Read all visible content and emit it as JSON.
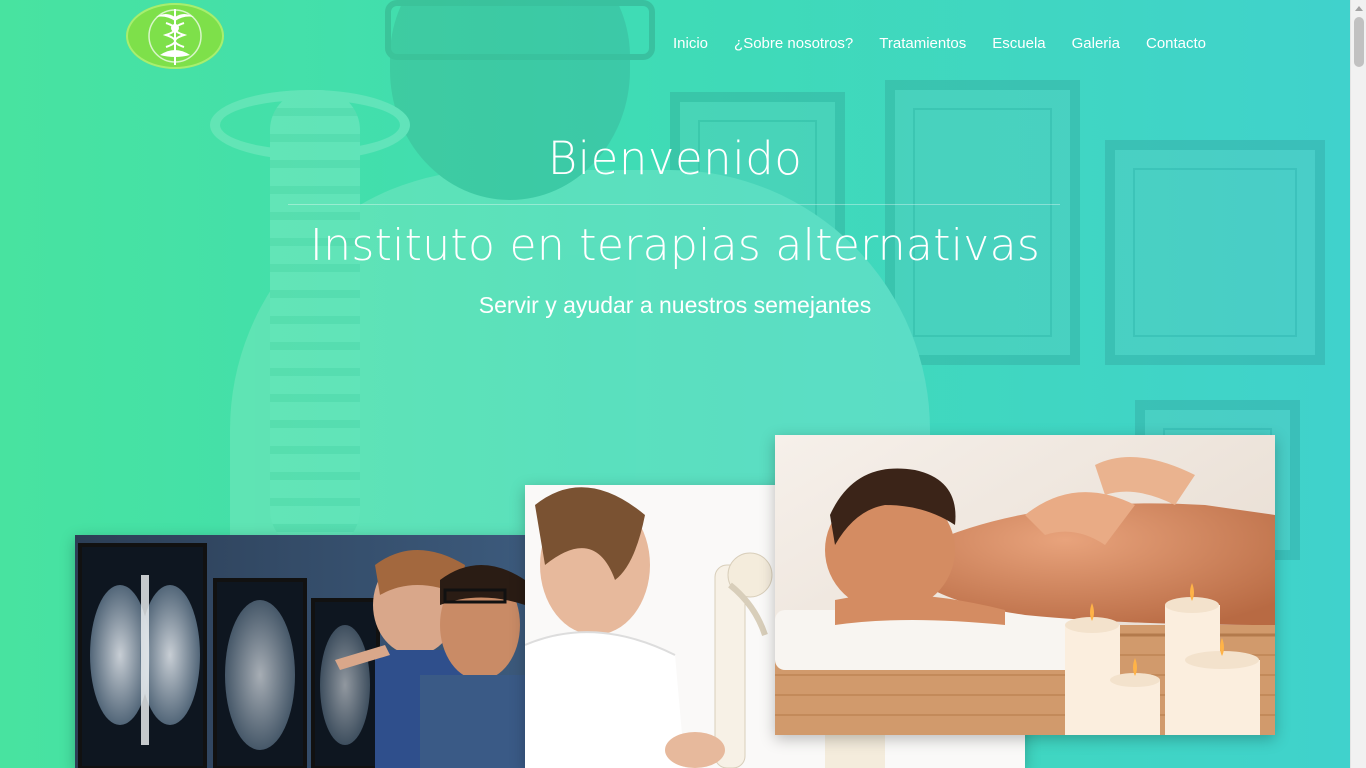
{
  "nav": {
    "logo_icon": "caduceus-meditation-logo-icon",
    "items": [
      {
        "label": "Inicio"
      },
      {
        "label": "¿Sobre nosotros?"
      },
      {
        "label": "Tratamientos"
      },
      {
        "label": "Escuela"
      },
      {
        "label": "Galeria"
      },
      {
        "label": "Contacto"
      }
    ]
  },
  "hero": {
    "welcome": "Bienvenido",
    "title": "Instituto en terapias alternativas",
    "subtitle": "Servir y ayudar a nuestros semejantes"
  },
  "gallery": [
    {
      "icon": "xray-doctors-photo"
    },
    {
      "icon": "spine-model-doctor-photo"
    },
    {
      "icon": "massage-therapy-photo"
    }
  ],
  "colors": {
    "hero_gradient_start": "#48e3a0",
    "hero_gradient_end": "#40d2cc",
    "logo_green": "#7ee04a",
    "text": "#ffffff"
  }
}
